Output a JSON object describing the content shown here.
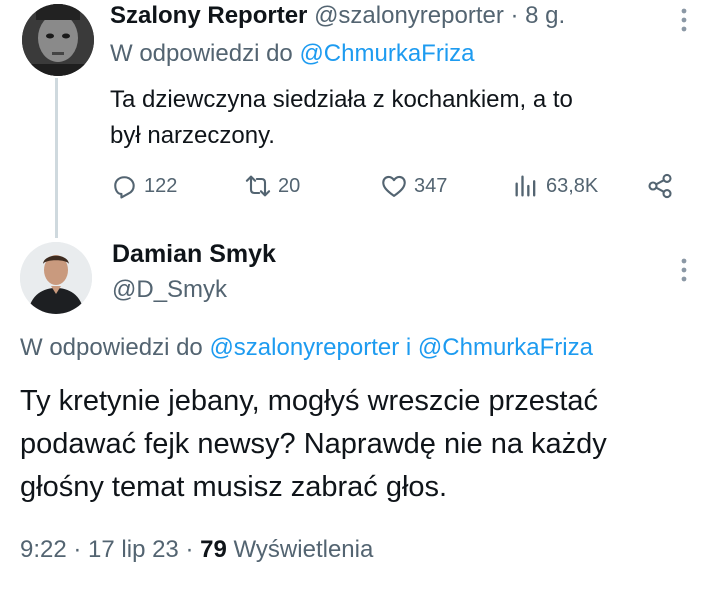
{
  "reply_tweet": {
    "display_name": "Szalony Reporter",
    "handle_time": "@szalonyreporter · 8 g.",
    "reply_prefix": "W odpowiedzi do",
    "reply_to": "@ChmurkaFriza",
    "text_line1": "Ta dziewczyna siedziała z kochankiem, a to",
    "text_line2": "był narzeczony.",
    "actions": {
      "replies": "122",
      "retweets": "20",
      "likes": "347",
      "views": "63,8K"
    }
  },
  "main_tweet": {
    "display_name": "Damian Smyk",
    "handle": "@D_Smyk",
    "reply_prefix": "W odpowiedzi do",
    "reply_to_1": "@szalonyreporter",
    "reply_conj": "i",
    "reply_to_2": "@ChmurkaFriza",
    "text_line1": "Ty kretynie jebany, mogłyś wreszcie przestać",
    "text_line2": "podawać fejk newsy? Naprawdę nie na każdy",
    "text_line3": "głośny temat musisz zabrać głos.",
    "time": "9:22 · 17 lip 23 ·",
    "views_count": "79",
    "views_label": "Wyświetlenia"
  },
  "colors": {
    "accent": "#1d9bf0",
    "secondary_text": "#536471",
    "primary_text": "#0f1419",
    "thread_line": "#cfd9de"
  },
  "icons": [
    "more-icon",
    "reply-icon",
    "retweet-icon",
    "like-icon",
    "views-icon",
    "share-icon"
  ]
}
